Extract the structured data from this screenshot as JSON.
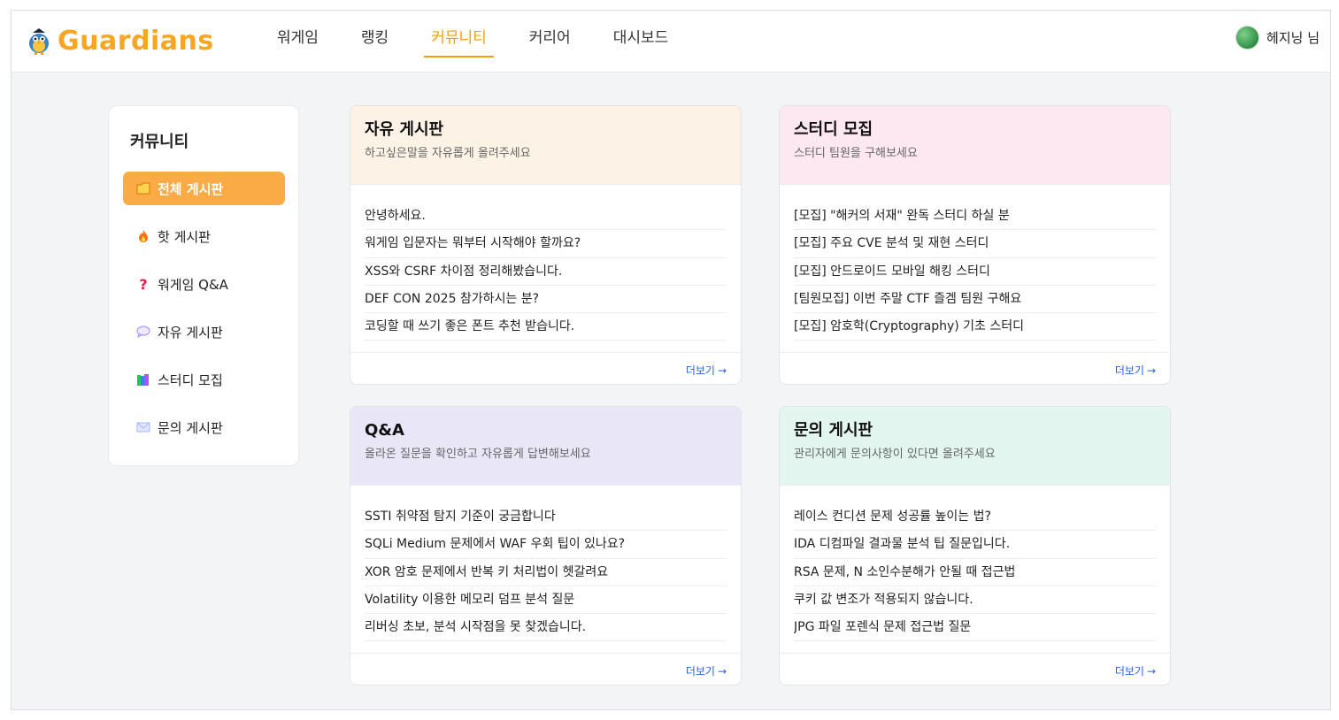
{
  "brand": {
    "name": "Guardians",
    "color": "#f6a623"
  },
  "nav": [
    {
      "label": "워게임",
      "active": false
    },
    {
      "label": "랭킹",
      "active": false
    },
    {
      "label": "커뮤니티",
      "active": true
    },
    {
      "label": "커리어",
      "active": false
    },
    {
      "label": "대시보드",
      "active": false
    }
  ],
  "user": {
    "name": "헤지닝 님",
    "avatar_icon": "avatar-icon"
  },
  "sidebar": {
    "title": "커뮤니티",
    "items": [
      {
        "label": "전체 게시판",
        "icon": "folder-icon",
        "active": true
      },
      {
        "label": "핫 게시판",
        "icon": "fire-icon",
        "active": false
      },
      {
        "label": "워게임 Q&A",
        "icon": "question-icon",
        "active": false
      },
      {
        "label": "자유 게시판",
        "icon": "speech-bubble-icon",
        "active": false
      },
      {
        "label": "스터디 모집",
        "icon": "books-icon",
        "active": false
      },
      {
        "label": "문의 게시판",
        "icon": "envelope-icon",
        "active": false
      }
    ]
  },
  "boards": [
    {
      "title": "자유 게시판",
      "subtitle": "하고싶은말을 자유롭게 올려주세요",
      "posts": [
        "안녕하세요.",
        "워게임 입문자는 뭐부터 시작해야 할까요?",
        "XSS와 CSRF 차이점 정리해봤습니다.",
        "DEF CON 2025 참가하시는 분?",
        "코딩할 때 쓰기 좋은 폰트 추천 받습니다."
      ],
      "more": "더보기"
    },
    {
      "title": "스터디 모집",
      "subtitle": "스터디 팀원을 구해보세요",
      "posts": [
        "[모집] \"해커의 서재\" 완독 스터디 하실 분",
        "[모집] 주요 CVE 분석 및 재현 스터디",
        "[모집] 안드로이드 모바일 해킹 스터디",
        "[팀원모집] 이번 주말 CTF 즐겜 팀원 구해요",
        "[모집] 암호학(Cryptography) 기초 스터디"
      ],
      "more": "더보기"
    },
    {
      "title": "Q&A",
      "subtitle": "올라온 질문을 확인하고 자유롭게 답변해보세요",
      "posts": [
        "SSTI 취약점 탐지 기준이 궁금합니다",
        "SQLi Medium 문제에서 WAF 우회 팁이 있나요?",
        "XOR 암호 문제에서 반복 키 처리법이 헷갈려요",
        "Volatility 이용한 메모리 덤프 분석 질문",
        "리버싱 초보, 분석 시작점을 못 찾겠습니다."
      ],
      "more": "더보기"
    },
    {
      "title": "문의 게시판",
      "subtitle": "관리자에게 문의사항이 있다면 올려주세요",
      "posts": [
        "레이스 컨디션 문제 성공률 높이는 법?",
        "IDA 디컴파일 결과물 분석 팁 질문입니다.",
        "RSA 문제, N 소인수분해가 안될 때 접근법",
        "쿠키 값 변조가 적용되지 않습니다.",
        "JPG 파일 포렌식 문제 접근법 질문"
      ],
      "more": "더보기"
    }
  ]
}
